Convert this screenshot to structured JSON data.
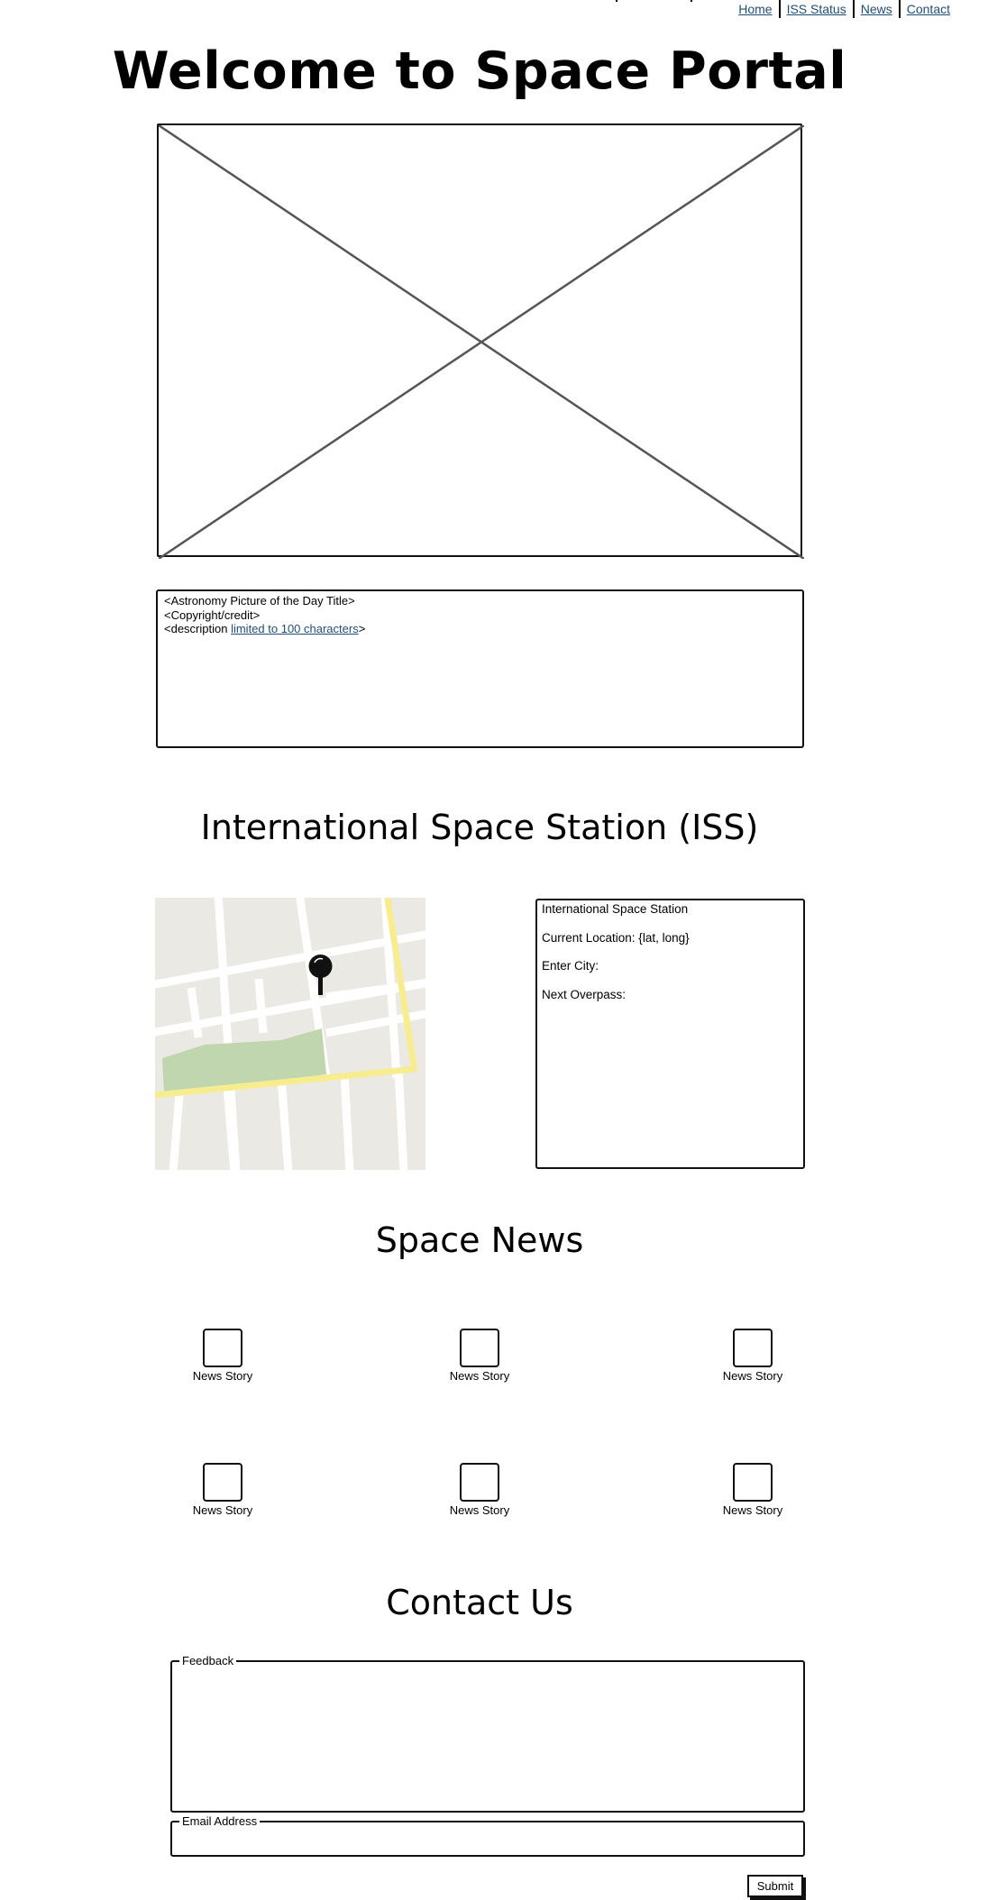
{
  "nav": {
    "items": [
      "Home",
      "ISS Status",
      "News",
      "Contact"
    ]
  },
  "header": {
    "title": "Welcome to Space Portal"
  },
  "apod": {
    "title_line": "<Astronomy Picture of the Day Title>",
    "credit_line": "<Copyright/credit>",
    "desc_prefix": "<description ",
    "desc_link": "limited to 100 characters",
    "desc_suffix": ">"
  },
  "iss": {
    "heading": "International Space Station (ISS)",
    "box_title": "International Space Station",
    "current_location": "Current Location: {lat, long}",
    "enter_city": "Enter City:",
    "next_overpass": "Next Overpass:"
  },
  "news": {
    "heading": "Space News",
    "stories": [
      "News Story",
      "News Story",
      "News Story",
      "News Story",
      "News Story",
      "News Story"
    ]
  },
  "contact": {
    "heading": "Contact Us",
    "feedback_label": "Feedback",
    "feedback_value": "",
    "email_label": "Email Address",
    "email_value": "",
    "submit_label": "Submit"
  },
  "colors": {
    "link": "#1f4e79",
    "map_land": "#ebe9e3",
    "map_park": "#bfd6ae",
    "map_highway": "#f7ec8f"
  }
}
